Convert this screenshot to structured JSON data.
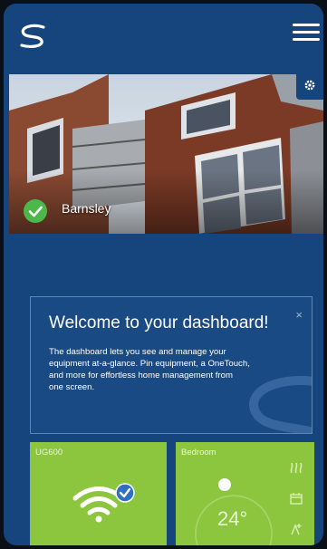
{
  "app": {
    "logo_icon": "swirl-logo-icon",
    "menu_icon": "hamburger-menu-icon",
    "settings_icon": "gear-icon",
    "colors": {
      "background": "#16447c",
      "tile_green": "#8cc63f",
      "status_green": "#4cb849",
      "badge_blue": "#2f6fc4"
    }
  },
  "site": {
    "name": "Barnsley",
    "status_icon": "check-circle-icon"
  },
  "welcome": {
    "title": "Welcome to your dashboard!",
    "close_label": "×",
    "lines": [
      "The dashboard lets you see and manage your",
      "equipment at-a-glance. Pin equipment, a OneTouch,",
      "and more for effortless home management from",
      "one screen."
    ]
  },
  "tiles": {
    "device": {
      "label": "UG600",
      "icon": "wifi-icon",
      "badge_icon": "check-badge-icon"
    },
    "thermostat": {
      "label": "Bedroom",
      "temperature": "24°",
      "icons": [
        "heat-mode-icon",
        "schedule-icon",
        "boost-icon"
      ]
    }
  }
}
